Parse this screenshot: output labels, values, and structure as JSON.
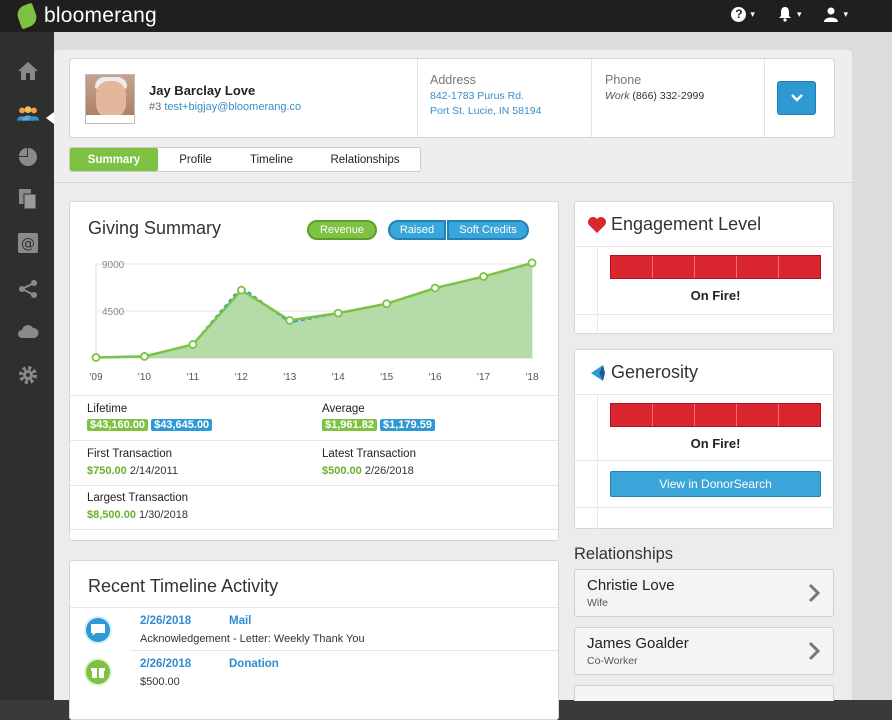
{
  "app": {
    "name": "bloomerang"
  },
  "topbar": {
    "help_icon": "question-circle-icon",
    "notifications_icon": "bell-icon",
    "user_icon": "user-icon"
  },
  "sidebar": {
    "items": [
      "home-icon",
      "constituents-icon",
      "reports-icon",
      "documents-icon",
      "email-icon",
      "share-icon",
      "cloud-icon",
      "settings-icon"
    ]
  },
  "profile": {
    "name": "Jay Barclay Love",
    "id": "#3",
    "email": "test+bigjay@bloomerang.co",
    "address_label": "Address",
    "address_line1": "842-1783 Purus Rd.",
    "address_line2": "Port St. Lucie, IN 58194",
    "phone_label": "Phone",
    "phone_type": "Work",
    "phone_number": "(866) 332-2999"
  },
  "tabs": [
    {
      "label": "Summary",
      "active": true
    },
    {
      "label": "Profile",
      "active": false
    },
    {
      "label": "Timeline",
      "active": false
    },
    {
      "label": "Relationships",
      "active": false
    }
  ],
  "giving": {
    "title": "Giving Summary",
    "toggle_revenue": "Revenue",
    "toggle_raised": "Raised",
    "toggle_soft": "Soft Credits",
    "lifetime_label": "Lifetime",
    "lifetime_revenue": "$43,160.00",
    "lifetime_raised": "$43,645.00",
    "average_label": "Average",
    "average_revenue": "$1,961.82",
    "average_raised": "$1,179.59",
    "first_label": "First Transaction",
    "first_amount": "$750.00",
    "first_date": "2/14/2011",
    "latest_label": "Latest Transaction",
    "latest_amount": "$500.00",
    "latest_date": "2/26/2018",
    "largest_label": "Largest Transaction",
    "largest_amount": "$8,500.00",
    "largest_date": "1/30/2018"
  },
  "chart_data": {
    "type": "area",
    "x": [
      "'09",
      "'10",
      "'11",
      "'12",
      "'13",
      "'14",
      "'15",
      "'16",
      "'17",
      "'18"
    ],
    "yticks": [
      "9000",
      "4500"
    ],
    "ylim": [
      0,
      9000
    ],
    "series": [
      {
        "values": [
          50,
          150,
          1300,
          6500,
          3600,
          4300,
          5200,
          6700,
          7800,
          9100
        ],
        "color": "#7dc242"
      },
      {
        "values": [
          50,
          150,
          1300,
          6800,
          3400,
          4300,
          5200,
          6700,
          7800,
          9100
        ],
        "color": "#2f99d4"
      }
    ]
  },
  "engagement": {
    "title": "Engagement Level",
    "status": "On Fire!",
    "icon": "heart-icon"
  },
  "generosity": {
    "title": "Generosity",
    "status": "On Fire!",
    "button": "View in DonorSearch",
    "icon": "donorsearch-logo-icon"
  },
  "relationships": {
    "title": "Relationships",
    "items": [
      {
        "name": "Christie Love",
        "role": "Wife"
      },
      {
        "name": "James Goalder",
        "role": "Co-Worker"
      }
    ]
  },
  "timeline": {
    "title": "Recent Timeline Activity",
    "items": [
      {
        "date": "2/26/2018",
        "type": "Mail",
        "desc": "Acknowledgement - Letter: Weekly Thank You",
        "icon": "mail-bubble-icon"
      },
      {
        "date": "2/26/2018",
        "type": "Donation",
        "desc": "$500.00",
        "icon": "gift-icon"
      }
    ]
  }
}
